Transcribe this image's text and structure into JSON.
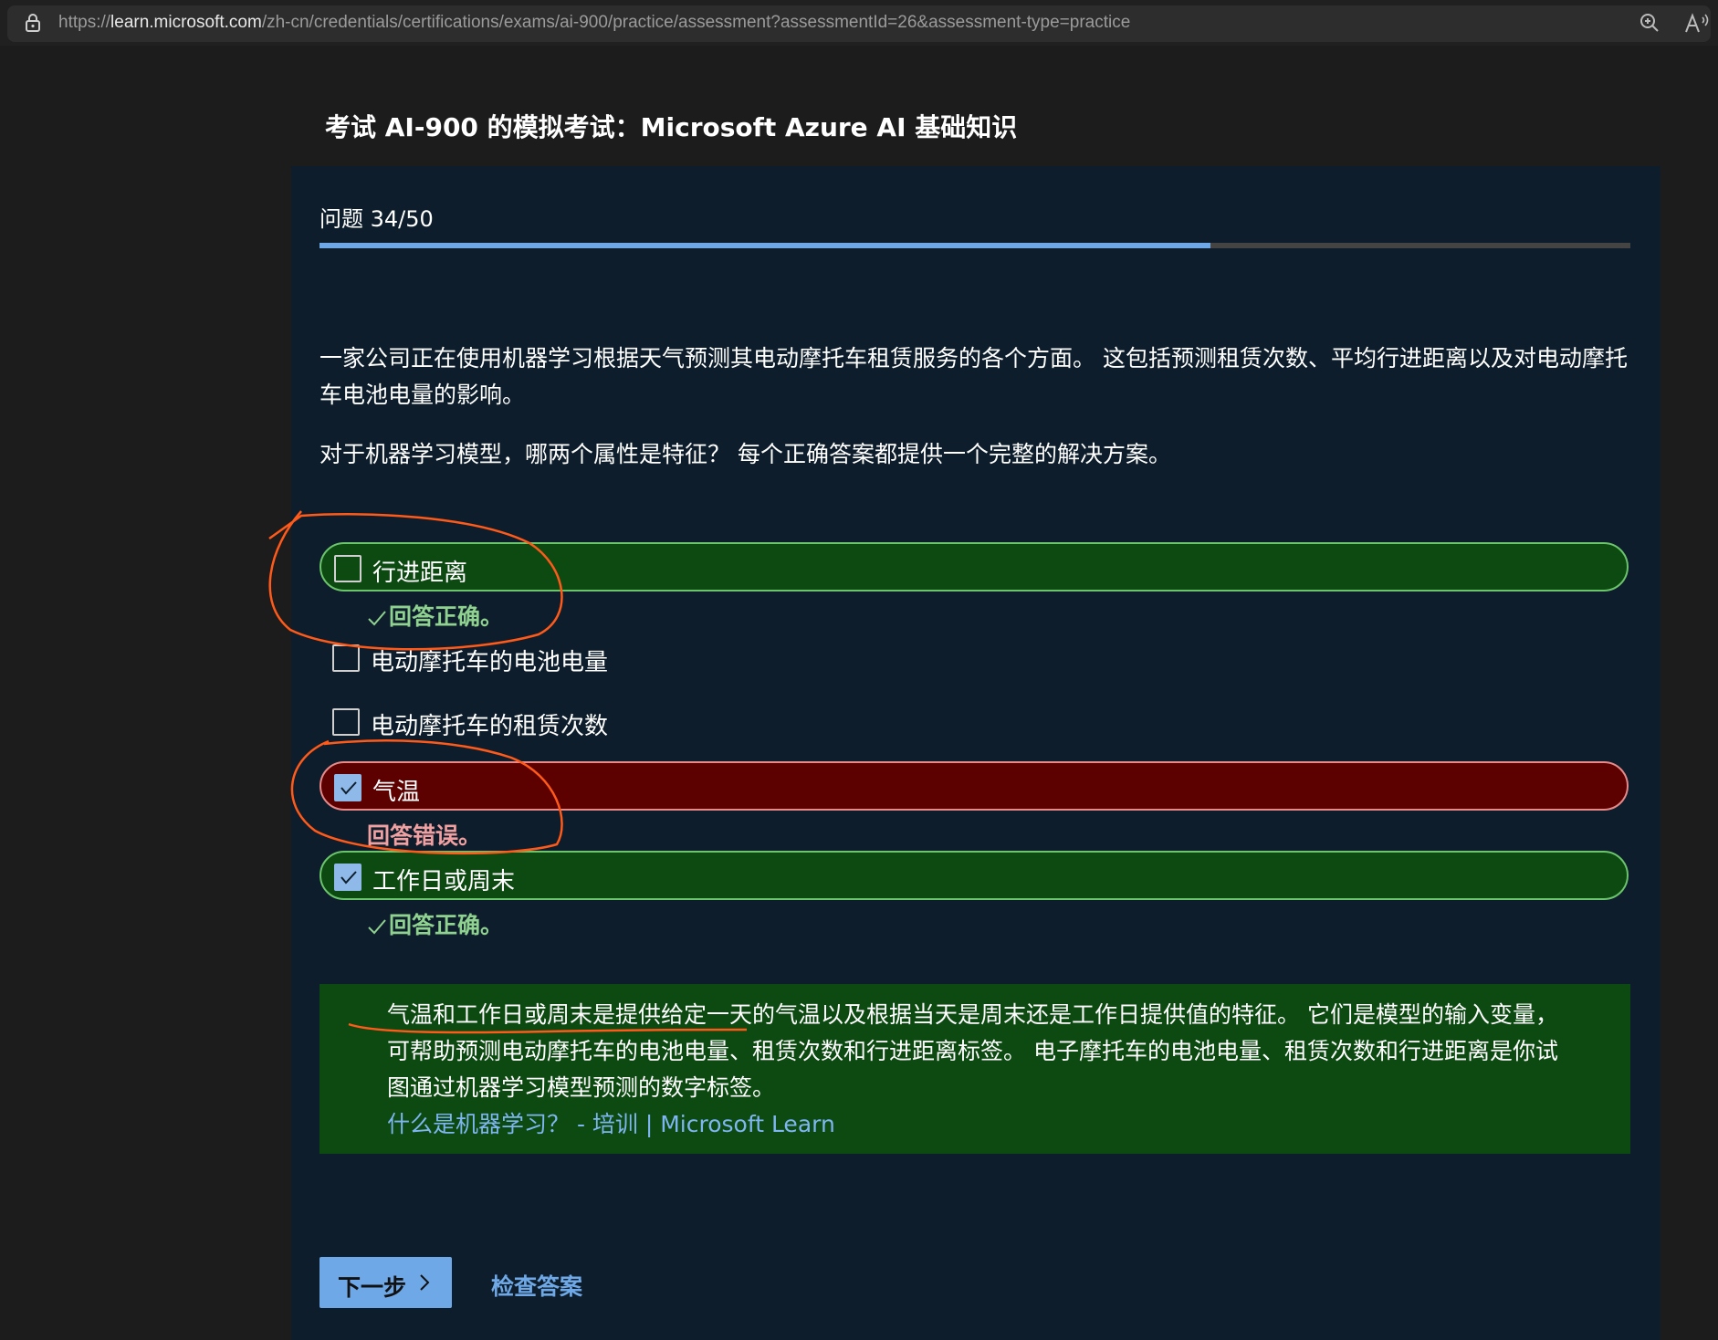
{
  "browser": {
    "url_scheme": "https://",
    "url_domain": "learn.microsoft.com",
    "url_path": "/zh-cn/credentials/certifications/exams/ai-900/practice/assessment?assessmentId=26&assessment-type=practice",
    "icons": [
      "lock-icon",
      "zoom-icon",
      "read-aloud-icon"
    ]
  },
  "page": {
    "title": "考试 AI-900 的模拟考试：Microsoft Azure AI 基础知识"
  },
  "question": {
    "counter": "问题 34/50",
    "progress": 0.68,
    "stem_line1": "一家公司正在使用机器学习根据天气预测其电动摩托车租赁服务的各个方面。 这包括预测租赁次数、平均行进距离以及对电动摩托车电池电量的影响。",
    "stem_line2": "对于机器学习模型，哪两个属性是特征？ 每个正确答案都提供一个完整的解决方案。"
  },
  "options": [
    {
      "label": "行进距离",
      "checked": false,
      "state": "correct",
      "feedback": "回答正确。"
    },
    {
      "label": "电动摩托车的电池电量",
      "checked": false,
      "state": "none",
      "feedback": ""
    },
    {
      "label": "电动摩托车的租赁次数",
      "checked": false,
      "state": "none",
      "feedback": ""
    },
    {
      "label": "气温",
      "checked": true,
      "state": "incorrect",
      "feedback": "回答错误。"
    },
    {
      "label": "工作日或周末",
      "checked": true,
      "state": "correct",
      "feedback": "回答正确。"
    }
  ],
  "explanation": {
    "text": "气温和工作日或周末是提供给定一天的气温以及根据当天是周末还是工作日提供值的特征。 它们是模型的输入变量，可帮助预测电动摩托车的电池电量、租赁次数和行进距离标签。 电子摩托车的电池电量、租赁次数和行进距离是你试图通过机器学习模型预测的数字标签。",
    "link": "什么是机器学习？ - 培训 | Microsoft Learn"
  },
  "actions": {
    "next_label": "下一步",
    "check_label": "检查答案"
  },
  "colors": {
    "accent": "#6fa8e6",
    "correct_bg": "#0c4a11",
    "incorrect_bg": "#5c0000",
    "annotation": "#ff5a1a"
  }
}
